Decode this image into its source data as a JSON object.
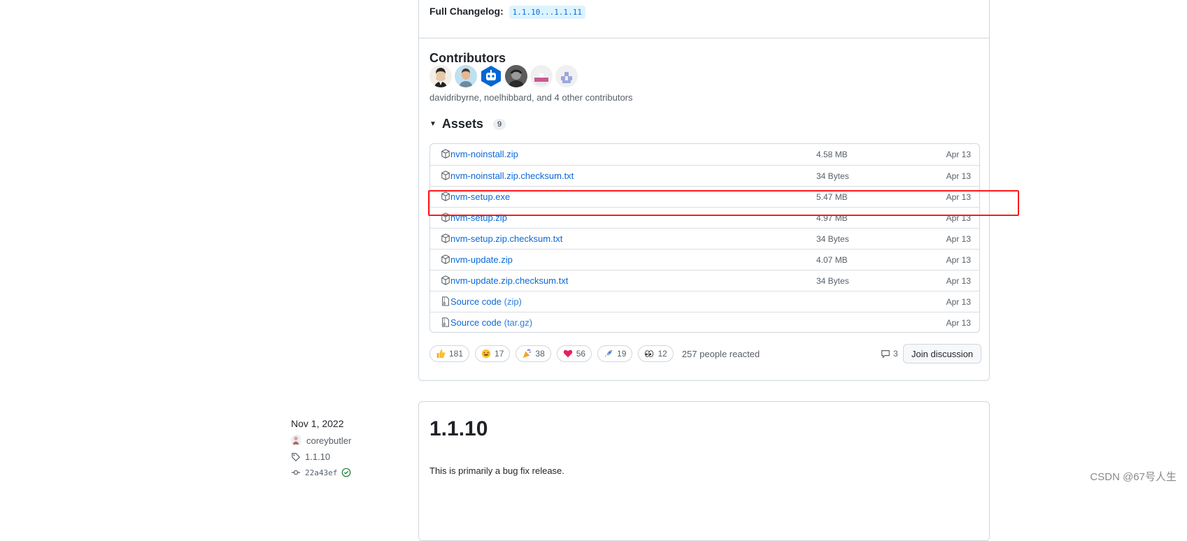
{
  "release": {
    "changelog_label": "Full Changelog:",
    "changelog_link": "1.1.10...1.1.11",
    "contributors_title": "Contributors",
    "contributors_text": "davidribyrne, noelhibbard, and 4 other contributors",
    "assets_title": "Assets",
    "assets_count": "9",
    "assets": [
      {
        "name": "nvm-noinstall.zip",
        "suffix": "",
        "size": "4.58 MB",
        "date": "Apr 13",
        "icon": "package-icon"
      },
      {
        "name": "nvm-noinstall.zip.checksum.txt",
        "suffix": "",
        "size": "34 Bytes",
        "date": "Apr 13",
        "icon": "package-icon"
      },
      {
        "name": "nvm-setup.exe",
        "suffix": "",
        "size": "5.47 MB",
        "date": "Apr 13",
        "icon": "package-icon"
      },
      {
        "name": "nvm-setup.zip",
        "suffix": "",
        "size": "4.97 MB",
        "date": "Apr 13",
        "icon": "package-icon"
      },
      {
        "name": "nvm-setup.zip.checksum.txt",
        "suffix": "",
        "size": "34 Bytes",
        "date": "Apr 13",
        "icon": "package-icon"
      },
      {
        "name": "nvm-update.zip",
        "suffix": "",
        "size": "4.07 MB",
        "date": "Apr 13",
        "icon": "package-icon"
      },
      {
        "name": "nvm-update.zip.checksum.txt",
        "suffix": "",
        "size": "34 Bytes",
        "date": "Apr 13",
        "icon": "package-icon"
      },
      {
        "name": "Source code",
        "suffix": " (zip)",
        "size": "",
        "date": "Apr 13",
        "icon": "file-zip-icon"
      },
      {
        "name": "Source code",
        "suffix": " (tar.gz)",
        "size": "",
        "date": "Apr 13",
        "icon": "file-zip-icon"
      }
    ],
    "reactions": [
      {
        "emoji": "thumbs-up",
        "count": "181"
      },
      {
        "emoji": "laugh",
        "count": "17"
      },
      {
        "emoji": "tada",
        "count": "38"
      },
      {
        "emoji": "heart",
        "count": "56"
      },
      {
        "emoji": "rocket",
        "count": "19"
      },
      {
        "emoji": "eyes",
        "count": "12"
      }
    ],
    "reacted_text": "257 people reacted",
    "comments_count": "3",
    "join_label": "Join discussion"
  },
  "older_release": {
    "date": "Nov 1, 2022",
    "author": "coreybutler",
    "tag": "1.1.10",
    "commit": "22a43ef",
    "title": "1.1.10",
    "description": "This is primarily a bug fix release."
  },
  "watermark": "CSDN @67号人生",
  "colors": {
    "link": "#0969da",
    "highlight": "#ff1a1a",
    "border": "#d0d7de",
    "verified": "#1a7f37"
  }
}
